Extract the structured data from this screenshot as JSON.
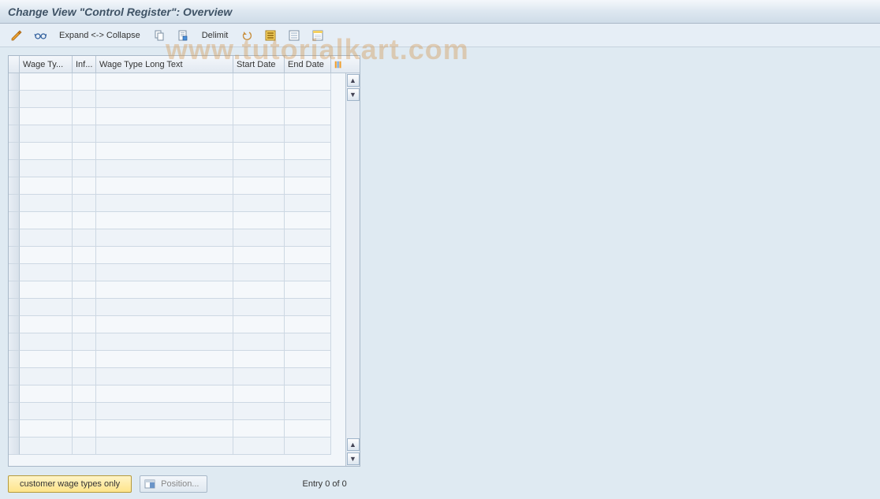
{
  "title": "Change View \"Control Register\": Overview",
  "watermark": "www.tutorialkart.com",
  "toolbar": {
    "expand_collapse_label": "Expand <-> Collapse",
    "delimit_label": "Delimit"
  },
  "table": {
    "columns": {
      "wage_type": "Wage Ty...",
      "infotype": "Inf...",
      "long_text": "Wage Type Long Text",
      "start_date": "Start Date",
      "end_date": "End Date"
    },
    "rows": [],
    "visible_row_count": 22
  },
  "footer": {
    "customer_btn": "customer wage types only",
    "position_btn": "Position...",
    "status": "Entry 0 of 0"
  }
}
